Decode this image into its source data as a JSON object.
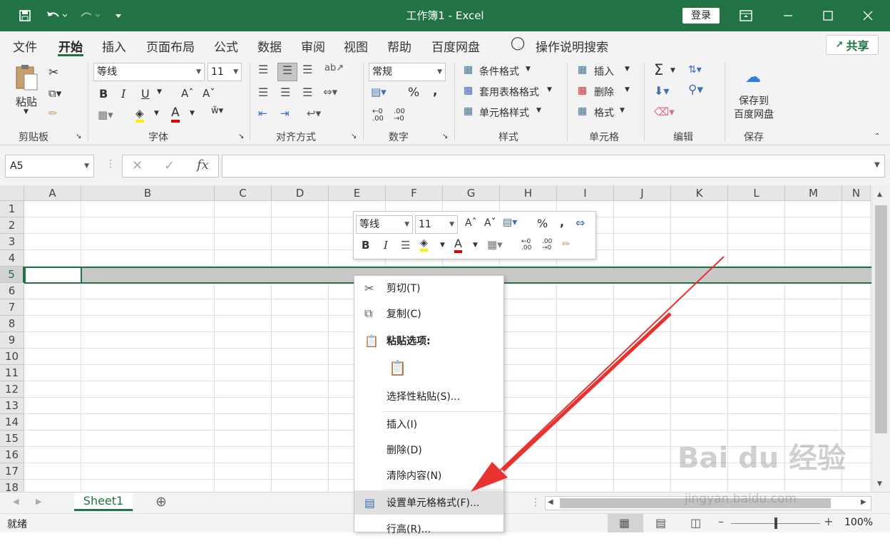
{
  "window": {
    "title": "工作簿1  -  Excel",
    "login": "登录"
  },
  "menu": {
    "items": [
      "文件",
      "开始",
      "插入",
      "页面布局",
      "公式",
      "数据",
      "审阅",
      "视图",
      "帮助",
      "百度网盘"
    ],
    "search": "操作说明搜索",
    "share": "共享"
  },
  "ribbon": {
    "clipboard": {
      "paste": "粘贴",
      "label": "剪贴板"
    },
    "font": {
      "name": "等线",
      "size": "11",
      "label": "字体",
      "bold": "B",
      "italic": "I",
      "underline": "U"
    },
    "align": {
      "label": "对齐方式"
    },
    "number": {
      "format": "常规",
      "label": "数字",
      "percent": "%",
      "comma": ","
    },
    "styles": {
      "cond": "条件格式",
      "table": "套用表格格式",
      "cell": "单元格样式",
      "label": "样式"
    },
    "cells": {
      "insert": "插入",
      "delete": "删除",
      "format": "格式",
      "label": "单元格"
    },
    "edit": {
      "label": "编辑"
    },
    "save": {
      "line1": "保存到",
      "line2": "百度网盘",
      "label": "保存"
    }
  },
  "formulabar": {
    "namebox": "A5",
    "fx": "fx"
  },
  "grid": {
    "columns": [
      "A",
      "B",
      "C",
      "D",
      "E",
      "F",
      "G",
      "H",
      "I",
      "J",
      "K",
      "L",
      "M",
      "N"
    ],
    "rows": [
      "1",
      "2",
      "3",
      "4",
      "5",
      "6",
      "7",
      "8",
      "9",
      "10",
      "11",
      "12",
      "13",
      "14",
      "15",
      "16",
      "17",
      "18"
    ]
  },
  "minitoolbar": {
    "font": "等线",
    "size": "11",
    "bold": "B",
    "italic": "I",
    "percent": "%",
    "comma": ","
  },
  "context_menu": {
    "cut": "剪切(T)",
    "copy": "复制(C)",
    "paste_options": "粘贴选项:",
    "paste_special": "选择性粘贴(S)...",
    "insert": "插入(I)",
    "delete": "删除(D)",
    "clear": "清除内容(N)",
    "format_cells": "设置单元格格式(F)...",
    "row_height": "行高(R)..."
  },
  "sheets": {
    "tab": "Sheet1"
  },
  "status": {
    "ready": "就绪",
    "zoom": "100%"
  },
  "watermark": {
    "brand": "Bai du 经验",
    "url": "jingyan.baidu.com"
  },
  "colors": {
    "excel_green": "#217346",
    "arrow_red": "#e8322f"
  }
}
